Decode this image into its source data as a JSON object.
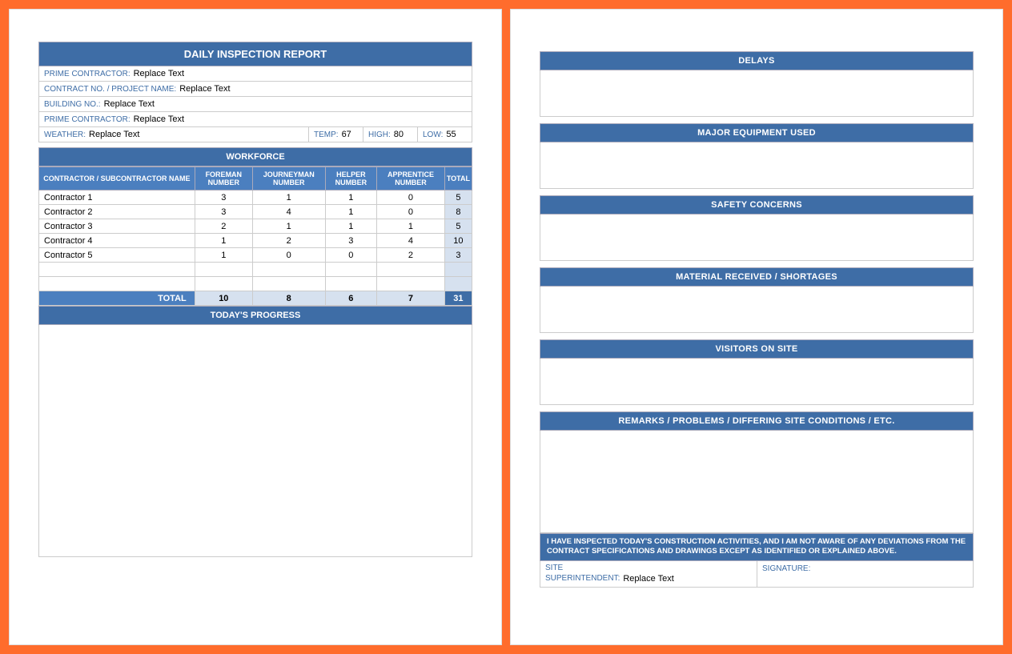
{
  "report": {
    "title": "DAILY INSPECTION REPORT",
    "fields": {
      "prime_contractor_label": "PRIME CONTRACTOR:",
      "prime_contractor_value": "Replace Text",
      "contract_label": "CONTRACT NO. / PROJECT NAME:",
      "contract_value": "Replace Text",
      "building_label": "BUILDING NO.:",
      "building_value": "Replace Text",
      "prime_contractor2_label": "PRIME CONTRACTOR:",
      "prime_contractor2_value": "Replace Text",
      "weather_label": "WEATHER:",
      "weather_value": "Replace Text",
      "temp_label": "TEMP:",
      "temp_value": "67",
      "high_label": "HIGH:",
      "high_value": "80",
      "low_label": "LOW:",
      "low_value": "55"
    },
    "workforce": {
      "header": "WORKFORCE",
      "columns": {
        "name": "CONTRACTOR / SUBCONTRACTOR NAME",
        "foreman": "FOREMAN NUMBER",
        "journeyman": "JOURNEYMAN NUMBER",
        "helper": "HELPER NUMBER",
        "apprentice": "APPRENTICE NUMBER",
        "total": "TOTAL"
      },
      "rows": [
        {
          "name": "Contractor 1",
          "foreman": "3",
          "journeyman": "1",
          "helper": "1",
          "apprentice": "0",
          "total": "5"
        },
        {
          "name": "Contractor 2",
          "foreman": "3",
          "journeyman": "4",
          "helper": "1",
          "apprentice": "0",
          "total": "8"
        },
        {
          "name": "Contractor 3",
          "foreman": "2",
          "journeyman": "1",
          "helper": "1",
          "apprentice": "1",
          "total": "5"
        },
        {
          "name": "Contractor 4",
          "foreman": "1",
          "journeyman": "2",
          "helper": "3",
          "apprentice": "4",
          "total": "10"
        },
        {
          "name": "Contractor 5",
          "foreman": "1",
          "journeyman": "0",
          "helper": "0",
          "apprentice": "2",
          "total": "3"
        }
      ],
      "total_label": "TOTAL",
      "totals": {
        "foreman": "10",
        "journeyman": "8",
        "helper": "6",
        "apprentice": "7",
        "total": "31"
      }
    },
    "progress_header": "TODAY'S PROGRESS"
  },
  "page2": {
    "delays": "DELAYS",
    "equipment": "MAJOR EQUIPMENT USED",
    "safety": "SAFETY CONCERNS",
    "material": "MATERIAL RECEIVED / SHORTAGES",
    "visitors": "VISITORS ON SITE",
    "remarks": "REMARKS / PROBLEMS / DIFFERING SITE CONDITIONS / ETC.",
    "certification": "I HAVE INSPECTED TODAY'S CONSTRUCTION ACTIVITIES, AND I AM NOT AWARE OF ANY DEVIATIONS FROM THE CONTRACT SPECIFICATIONS AND DRAWINGS EXCEPT AS IDENTIFIED OR EXPLAINED ABOVE.",
    "site_label": "SITE",
    "super_label": "SUPERINTENDENT:",
    "super_value": "Replace Text",
    "signature_label": "SIGNATURE:"
  }
}
